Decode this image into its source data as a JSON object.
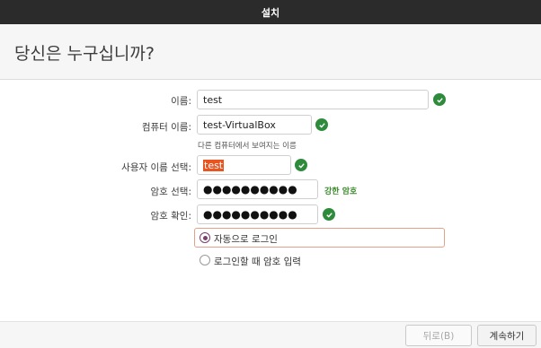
{
  "window": {
    "title": "설치"
  },
  "header": {
    "title": "당신은 누구십니까?"
  },
  "form": {
    "name_label": "이름:",
    "name_value": "test",
    "computer_label": "컴퓨터 이름:",
    "computer_value": "test-VirtualBox",
    "computer_hint": "다른 컴퓨터에서 보여지는 이름",
    "username_label": "사용자 이름 선택:",
    "username_value": "test",
    "password_label": "암호 선택:",
    "password_value": "●●●●●●●●●●",
    "password_strength": "강한 암호",
    "confirm_label": "암호 확인:",
    "confirm_value": "●●●●●●●●●●"
  },
  "login_options": [
    {
      "label": "자동으로 로그인",
      "selected": true
    },
    {
      "label": "로그인할 때 암호 입력",
      "selected": false
    }
  ],
  "buttons": {
    "back": "뒤로(B)",
    "continue": "계속하기"
  },
  "colors": {
    "valid_check": "#2e8b3c",
    "selection": "#e95420",
    "strength_text": "#3a8a2a"
  }
}
